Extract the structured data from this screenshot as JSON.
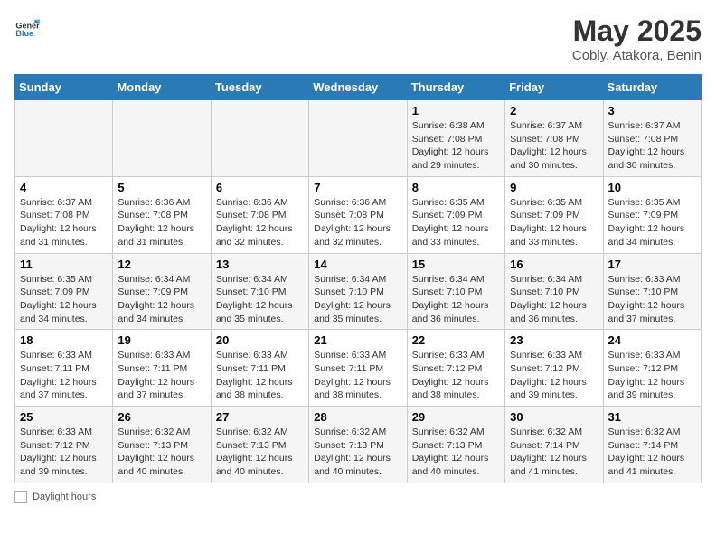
{
  "logo": {
    "line1": "General",
    "line2": "Blue"
  },
  "title": "May 2025",
  "subtitle": "Cobly, Atakora, Benin",
  "days_of_week": [
    "Sunday",
    "Monday",
    "Tuesday",
    "Wednesday",
    "Thursday",
    "Friday",
    "Saturday"
  ],
  "weeks": [
    [
      {
        "day": "",
        "info": ""
      },
      {
        "day": "",
        "info": ""
      },
      {
        "day": "",
        "info": ""
      },
      {
        "day": "",
        "info": ""
      },
      {
        "day": "1",
        "info": "Sunrise: 6:38 AM\nSunset: 7:08 PM\nDaylight: 12 hours and 29 minutes."
      },
      {
        "day": "2",
        "info": "Sunrise: 6:37 AM\nSunset: 7:08 PM\nDaylight: 12 hours and 30 minutes."
      },
      {
        "day": "3",
        "info": "Sunrise: 6:37 AM\nSunset: 7:08 PM\nDaylight: 12 hours and 30 minutes."
      }
    ],
    [
      {
        "day": "4",
        "info": "Sunrise: 6:37 AM\nSunset: 7:08 PM\nDaylight: 12 hours and 31 minutes."
      },
      {
        "day": "5",
        "info": "Sunrise: 6:36 AM\nSunset: 7:08 PM\nDaylight: 12 hours and 31 minutes."
      },
      {
        "day": "6",
        "info": "Sunrise: 6:36 AM\nSunset: 7:08 PM\nDaylight: 12 hours and 32 minutes."
      },
      {
        "day": "7",
        "info": "Sunrise: 6:36 AM\nSunset: 7:08 PM\nDaylight: 12 hours and 32 minutes."
      },
      {
        "day": "8",
        "info": "Sunrise: 6:35 AM\nSunset: 7:09 PM\nDaylight: 12 hours and 33 minutes."
      },
      {
        "day": "9",
        "info": "Sunrise: 6:35 AM\nSunset: 7:09 PM\nDaylight: 12 hours and 33 minutes."
      },
      {
        "day": "10",
        "info": "Sunrise: 6:35 AM\nSunset: 7:09 PM\nDaylight: 12 hours and 34 minutes."
      }
    ],
    [
      {
        "day": "11",
        "info": "Sunrise: 6:35 AM\nSunset: 7:09 PM\nDaylight: 12 hours and 34 minutes."
      },
      {
        "day": "12",
        "info": "Sunrise: 6:34 AM\nSunset: 7:09 PM\nDaylight: 12 hours and 34 minutes."
      },
      {
        "day": "13",
        "info": "Sunrise: 6:34 AM\nSunset: 7:10 PM\nDaylight: 12 hours and 35 minutes."
      },
      {
        "day": "14",
        "info": "Sunrise: 6:34 AM\nSunset: 7:10 PM\nDaylight: 12 hours and 35 minutes."
      },
      {
        "day": "15",
        "info": "Sunrise: 6:34 AM\nSunset: 7:10 PM\nDaylight: 12 hours and 36 minutes."
      },
      {
        "day": "16",
        "info": "Sunrise: 6:34 AM\nSunset: 7:10 PM\nDaylight: 12 hours and 36 minutes."
      },
      {
        "day": "17",
        "info": "Sunrise: 6:33 AM\nSunset: 7:10 PM\nDaylight: 12 hours and 37 minutes."
      }
    ],
    [
      {
        "day": "18",
        "info": "Sunrise: 6:33 AM\nSunset: 7:11 PM\nDaylight: 12 hours and 37 minutes."
      },
      {
        "day": "19",
        "info": "Sunrise: 6:33 AM\nSunset: 7:11 PM\nDaylight: 12 hours and 37 minutes."
      },
      {
        "day": "20",
        "info": "Sunrise: 6:33 AM\nSunset: 7:11 PM\nDaylight: 12 hours and 38 minutes."
      },
      {
        "day": "21",
        "info": "Sunrise: 6:33 AM\nSunset: 7:11 PM\nDaylight: 12 hours and 38 minutes."
      },
      {
        "day": "22",
        "info": "Sunrise: 6:33 AM\nSunset: 7:12 PM\nDaylight: 12 hours and 38 minutes."
      },
      {
        "day": "23",
        "info": "Sunrise: 6:33 AM\nSunset: 7:12 PM\nDaylight: 12 hours and 39 minutes."
      },
      {
        "day": "24",
        "info": "Sunrise: 6:33 AM\nSunset: 7:12 PM\nDaylight: 12 hours and 39 minutes."
      }
    ],
    [
      {
        "day": "25",
        "info": "Sunrise: 6:33 AM\nSunset: 7:12 PM\nDaylight: 12 hours and 39 minutes."
      },
      {
        "day": "26",
        "info": "Sunrise: 6:32 AM\nSunset: 7:13 PM\nDaylight: 12 hours and 40 minutes."
      },
      {
        "day": "27",
        "info": "Sunrise: 6:32 AM\nSunset: 7:13 PM\nDaylight: 12 hours and 40 minutes."
      },
      {
        "day": "28",
        "info": "Sunrise: 6:32 AM\nSunset: 7:13 PM\nDaylight: 12 hours and 40 minutes."
      },
      {
        "day": "29",
        "info": "Sunrise: 6:32 AM\nSunset: 7:13 PM\nDaylight: 12 hours and 40 minutes."
      },
      {
        "day": "30",
        "info": "Sunrise: 6:32 AM\nSunset: 7:14 PM\nDaylight: 12 hours and 41 minutes."
      },
      {
        "day": "31",
        "info": "Sunrise: 6:32 AM\nSunset: 7:14 PM\nDaylight: 12 hours and 41 minutes."
      }
    ]
  ],
  "footer": {
    "label": "Daylight hours"
  }
}
